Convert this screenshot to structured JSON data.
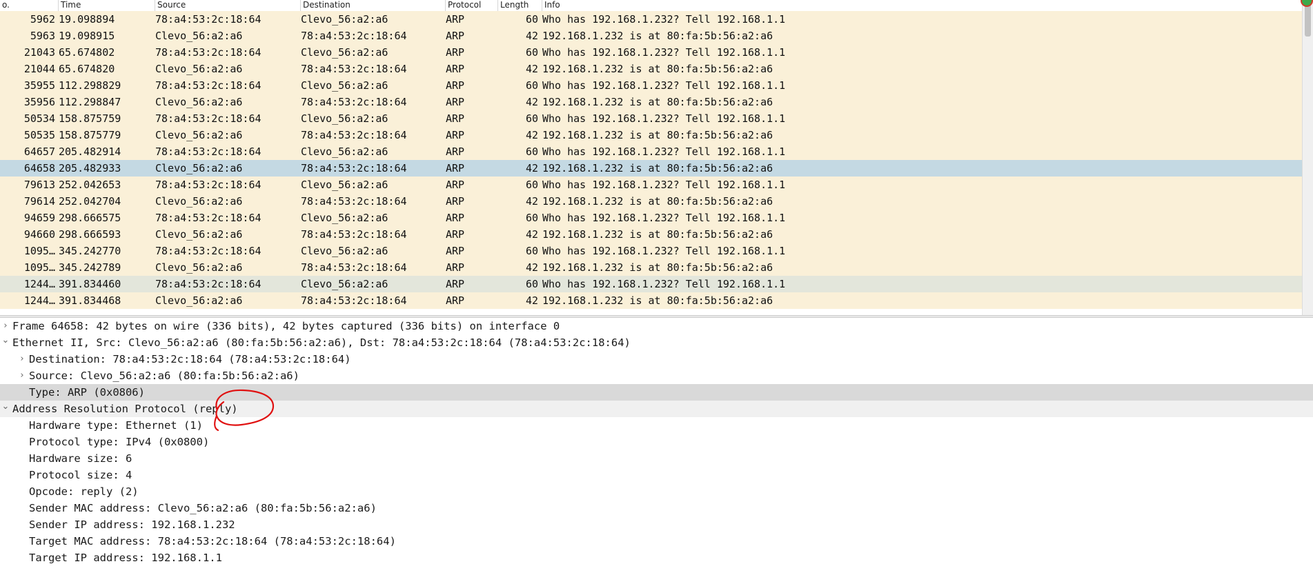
{
  "columns": {
    "no": "o.",
    "time": "Time",
    "source": "Source",
    "destination": "Destination",
    "protocol": "Protocol",
    "length": "Length",
    "info": "Info"
  },
  "packets": [
    {
      "no": "5962",
      "time": "19.098894",
      "source": "78:a4:53:2c:18:64",
      "destination": "Clevo_56:a2:a6",
      "protocol": "ARP",
      "length": "60",
      "info": "Who has 192.168.1.232? Tell 192.168.1.1"
    },
    {
      "no": "5963",
      "time": "19.098915",
      "source": "Clevo_56:a2:a6",
      "destination": "78:a4:53:2c:18:64",
      "protocol": "ARP",
      "length": "42",
      "info": "192.168.1.232 is at 80:fa:5b:56:a2:a6"
    },
    {
      "no": "21043",
      "time": "65.674802",
      "source": "78:a4:53:2c:18:64",
      "destination": "Clevo_56:a2:a6",
      "protocol": "ARP",
      "length": "60",
      "info": "Who has 192.168.1.232? Tell 192.168.1.1"
    },
    {
      "no": "21044",
      "time": "65.674820",
      "source": "Clevo_56:a2:a6",
      "destination": "78:a4:53:2c:18:64",
      "protocol": "ARP",
      "length": "42",
      "info": "192.168.1.232 is at 80:fa:5b:56:a2:a6"
    },
    {
      "no": "35955",
      "time": "112.298829",
      "source": "78:a4:53:2c:18:64",
      "destination": "Clevo_56:a2:a6",
      "protocol": "ARP",
      "length": "60",
      "info": "Who has 192.168.1.232? Tell 192.168.1.1"
    },
    {
      "no": "35956",
      "time": "112.298847",
      "source": "Clevo_56:a2:a6",
      "destination": "78:a4:53:2c:18:64",
      "protocol": "ARP",
      "length": "42",
      "info": "192.168.1.232 is at 80:fa:5b:56:a2:a6"
    },
    {
      "no": "50534",
      "time": "158.875759",
      "source": "78:a4:53:2c:18:64",
      "destination": "Clevo_56:a2:a6",
      "protocol": "ARP",
      "length": "60",
      "info": "Who has 192.168.1.232? Tell 192.168.1.1"
    },
    {
      "no": "50535",
      "time": "158.875779",
      "source": "Clevo_56:a2:a6",
      "destination": "78:a4:53:2c:18:64",
      "protocol": "ARP",
      "length": "42",
      "info": "192.168.1.232 is at 80:fa:5b:56:a2:a6"
    },
    {
      "no": "64657",
      "time": "205.482914",
      "source": "78:a4:53:2c:18:64",
      "destination": "Clevo_56:a2:a6",
      "protocol": "ARP",
      "length": "60",
      "info": "Who has 192.168.1.232? Tell 192.168.1.1"
    },
    {
      "no": "64658",
      "time": "205.482933",
      "source": "Clevo_56:a2:a6",
      "destination": "78:a4:53:2c:18:64",
      "protocol": "ARP",
      "length": "42",
      "info": "192.168.1.232 is at 80:fa:5b:56:a2:a6",
      "selected": true
    },
    {
      "no": "79613",
      "time": "252.042653",
      "source": "78:a4:53:2c:18:64",
      "destination": "Clevo_56:a2:a6",
      "protocol": "ARP",
      "length": "60",
      "info": "Who has 192.168.1.232? Tell 192.168.1.1"
    },
    {
      "no": "79614",
      "time": "252.042704",
      "source": "Clevo_56:a2:a6",
      "destination": "78:a4:53:2c:18:64",
      "protocol": "ARP",
      "length": "42",
      "info": "192.168.1.232 is at 80:fa:5b:56:a2:a6"
    },
    {
      "no": "94659",
      "time": "298.666575",
      "source": "78:a4:53:2c:18:64",
      "destination": "Clevo_56:a2:a6",
      "protocol": "ARP",
      "length": "60",
      "info": "Who has 192.168.1.232? Tell 192.168.1.1"
    },
    {
      "no": "94660",
      "time": "298.666593",
      "source": "Clevo_56:a2:a6",
      "destination": "78:a4:53:2c:18:64",
      "protocol": "ARP",
      "length": "42",
      "info": "192.168.1.232 is at 80:fa:5b:56:a2:a6"
    },
    {
      "no": "1095…",
      "time": "345.242770",
      "source": "78:a4:53:2c:18:64",
      "destination": "Clevo_56:a2:a6",
      "protocol": "ARP",
      "length": "60",
      "info": "Who has 192.168.1.232? Tell 192.168.1.1"
    },
    {
      "no": "1095…",
      "time": "345.242789",
      "source": "Clevo_56:a2:a6",
      "destination": "78:a4:53:2c:18:64",
      "protocol": "ARP",
      "length": "42",
      "info": "192.168.1.232 is at 80:fa:5b:56:a2:a6"
    },
    {
      "no": "1244…",
      "time": "391.834460",
      "source": "78:a4:53:2c:18:64",
      "destination": "Clevo_56:a2:a6",
      "protocol": "ARP",
      "length": "60",
      "info": "Who has 192.168.1.232? Tell 192.168.1.1",
      "alt": true
    },
    {
      "no": "1244…",
      "time": "391.834468",
      "source": "Clevo_56:a2:a6",
      "destination": "78:a4:53:2c:18:64",
      "protocol": "ARP",
      "length": "42",
      "info": "192.168.1.232 is at 80:fa:5b:56:a2:a6"
    }
  ],
  "details": [
    {
      "level": 0,
      "arrow": "collapsed",
      "text": "Frame 64658: 42 bytes on wire (336 bits), 42 bytes captured (336 bits) on interface 0"
    },
    {
      "level": 0,
      "arrow": "expanded",
      "text": "Ethernet II, Src: Clevo_56:a2:a6 (80:fa:5b:56:a2:a6), Dst: 78:a4:53:2c:18:64 (78:a4:53:2c:18:64)"
    },
    {
      "level": 1,
      "arrow": "collapsed",
      "text": "Destination: 78:a4:53:2c:18:64 (78:a4:53:2c:18:64)"
    },
    {
      "level": 1,
      "arrow": "collapsed",
      "text": "Source: Clevo_56:a2:a6 (80:fa:5b:56:a2:a6)"
    },
    {
      "level": 1,
      "arrow": "none",
      "text": "Type: ARP (0x0806)",
      "highlight": "strong"
    },
    {
      "level": 0,
      "arrow": "expanded",
      "text": "Address Resolution Protocol (reply)",
      "highlight": "light"
    },
    {
      "level": 1,
      "arrow": "none",
      "text": "Hardware type: Ethernet (1)"
    },
    {
      "level": 1,
      "arrow": "none",
      "text": "Protocol type: IPv4 (0x0800)"
    },
    {
      "level": 1,
      "arrow": "none",
      "text": "Hardware size: 6"
    },
    {
      "level": 1,
      "arrow": "none",
      "text": "Protocol size: 4"
    },
    {
      "level": 1,
      "arrow": "none",
      "text": "Opcode: reply (2)"
    },
    {
      "level": 1,
      "arrow": "none",
      "text": "Sender MAC address: Clevo_56:a2:a6 (80:fa:5b:56:a2:a6)"
    },
    {
      "level": 1,
      "arrow": "none",
      "text": "Sender IP address: 192.168.1.232"
    },
    {
      "level": 1,
      "arrow": "none",
      "text": "Target MAC address: 78:a4:53:2c:18:64 (78:a4:53:2c:18:64)"
    },
    {
      "level": 1,
      "arrow": "none",
      "text": "Target IP address: 192.168.1.1"
    }
  ],
  "annotation": {
    "color": "#e01010"
  },
  "colors": {
    "row_bg": "#faf0d8",
    "selected_row_bg": "#c4d9e3",
    "alt_row_bg": "#e3e6db"
  },
  "icons": {
    "collapsed_arrow": "chevron-right-icon",
    "expanded_arrow": "chevron-down-icon"
  }
}
